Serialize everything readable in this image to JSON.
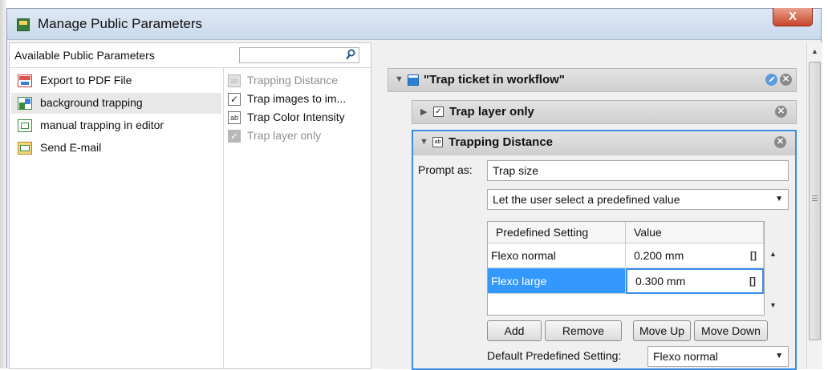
{
  "window": {
    "title": "Manage Public Parameters",
    "close_symbol": "X"
  },
  "left_panel": {
    "title": "Available Public Parameters",
    "search": {
      "value": "",
      "placeholder": ""
    },
    "workflows": [
      {
        "label": "Export to PDF File",
        "icon": "pdf-export-icon",
        "selected": false
      },
      {
        "label": "background trapping",
        "icon": "workflow-icon",
        "selected": true
      },
      {
        "label": "manual trapping in editor",
        "icon": "editor-icon",
        "selected": false
      },
      {
        "label": "Send E-mail",
        "icon": "email-icon",
        "selected": false
      }
    ],
    "parameters": [
      {
        "label": "Trapping Distance",
        "icon": "text-field-icon",
        "icon_text": "ab",
        "enabled": false
      },
      {
        "label": "Trap images to im...",
        "icon": "checkbox-icon",
        "icon_text": "✓",
        "enabled": true
      },
      {
        "label": "Trap Color Intensity",
        "icon": "text-field-icon",
        "icon_text": "ab",
        "enabled": true
      },
      {
        "label": "Trap layer only",
        "icon": "checkbox-icon",
        "icon_text": "✓",
        "enabled": false
      }
    ]
  },
  "right_panel": {
    "ticket": {
      "title": "\"Trap ticket in workflow\"",
      "arrow": "▼",
      "remove": "✕"
    },
    "layer_only": {
      "title": "Trap layer only",
      "arrow": "▶",
      "check": "✓",
      "remove": "✕"
    },
    "trapping_distance": {
      "title": "Trapping Distance",
      "arrow": "▼",
      "icon_text": "ab",
      "remove": "✕",
      "prompt_label": "Prompt as:",
      "prompt_value": "Trap size",
      "mode_select": "Let the user select a predefined value",
      "dropdown_arrow": "▼",
      "table": {
        "columns": [
          "Predefined Setting",
          "Value"
        ],
        "rows": [
          {
            "setting": "Flexo normal",
            "value": "0.200 mm",
            "unit_icon": "[]",
            "selected": false
          },
          {
            "setting": "Flexo large",
            "value": "0.300 mm",
            "unit_icon": "[]",
            "selected": true
          }
        ]
      },
      "buttons": {
        "add": "Add",
        "remove": "Remove",
        "move_up": "Move Up",
        "move_down": "Move Down"
      },
      "default_label": "Default Predefined Setting:",
      "default_value": "Flexo normal"
    }
  },
  "scroll_arrows": {
    "up": "▲",
    "down": "▼"
  },
  "colors": {
    "selection": "#3399ff",
    "focus_border": "#3a8ee6",
    "titlebar": "#dfe9f5"
  }
}
